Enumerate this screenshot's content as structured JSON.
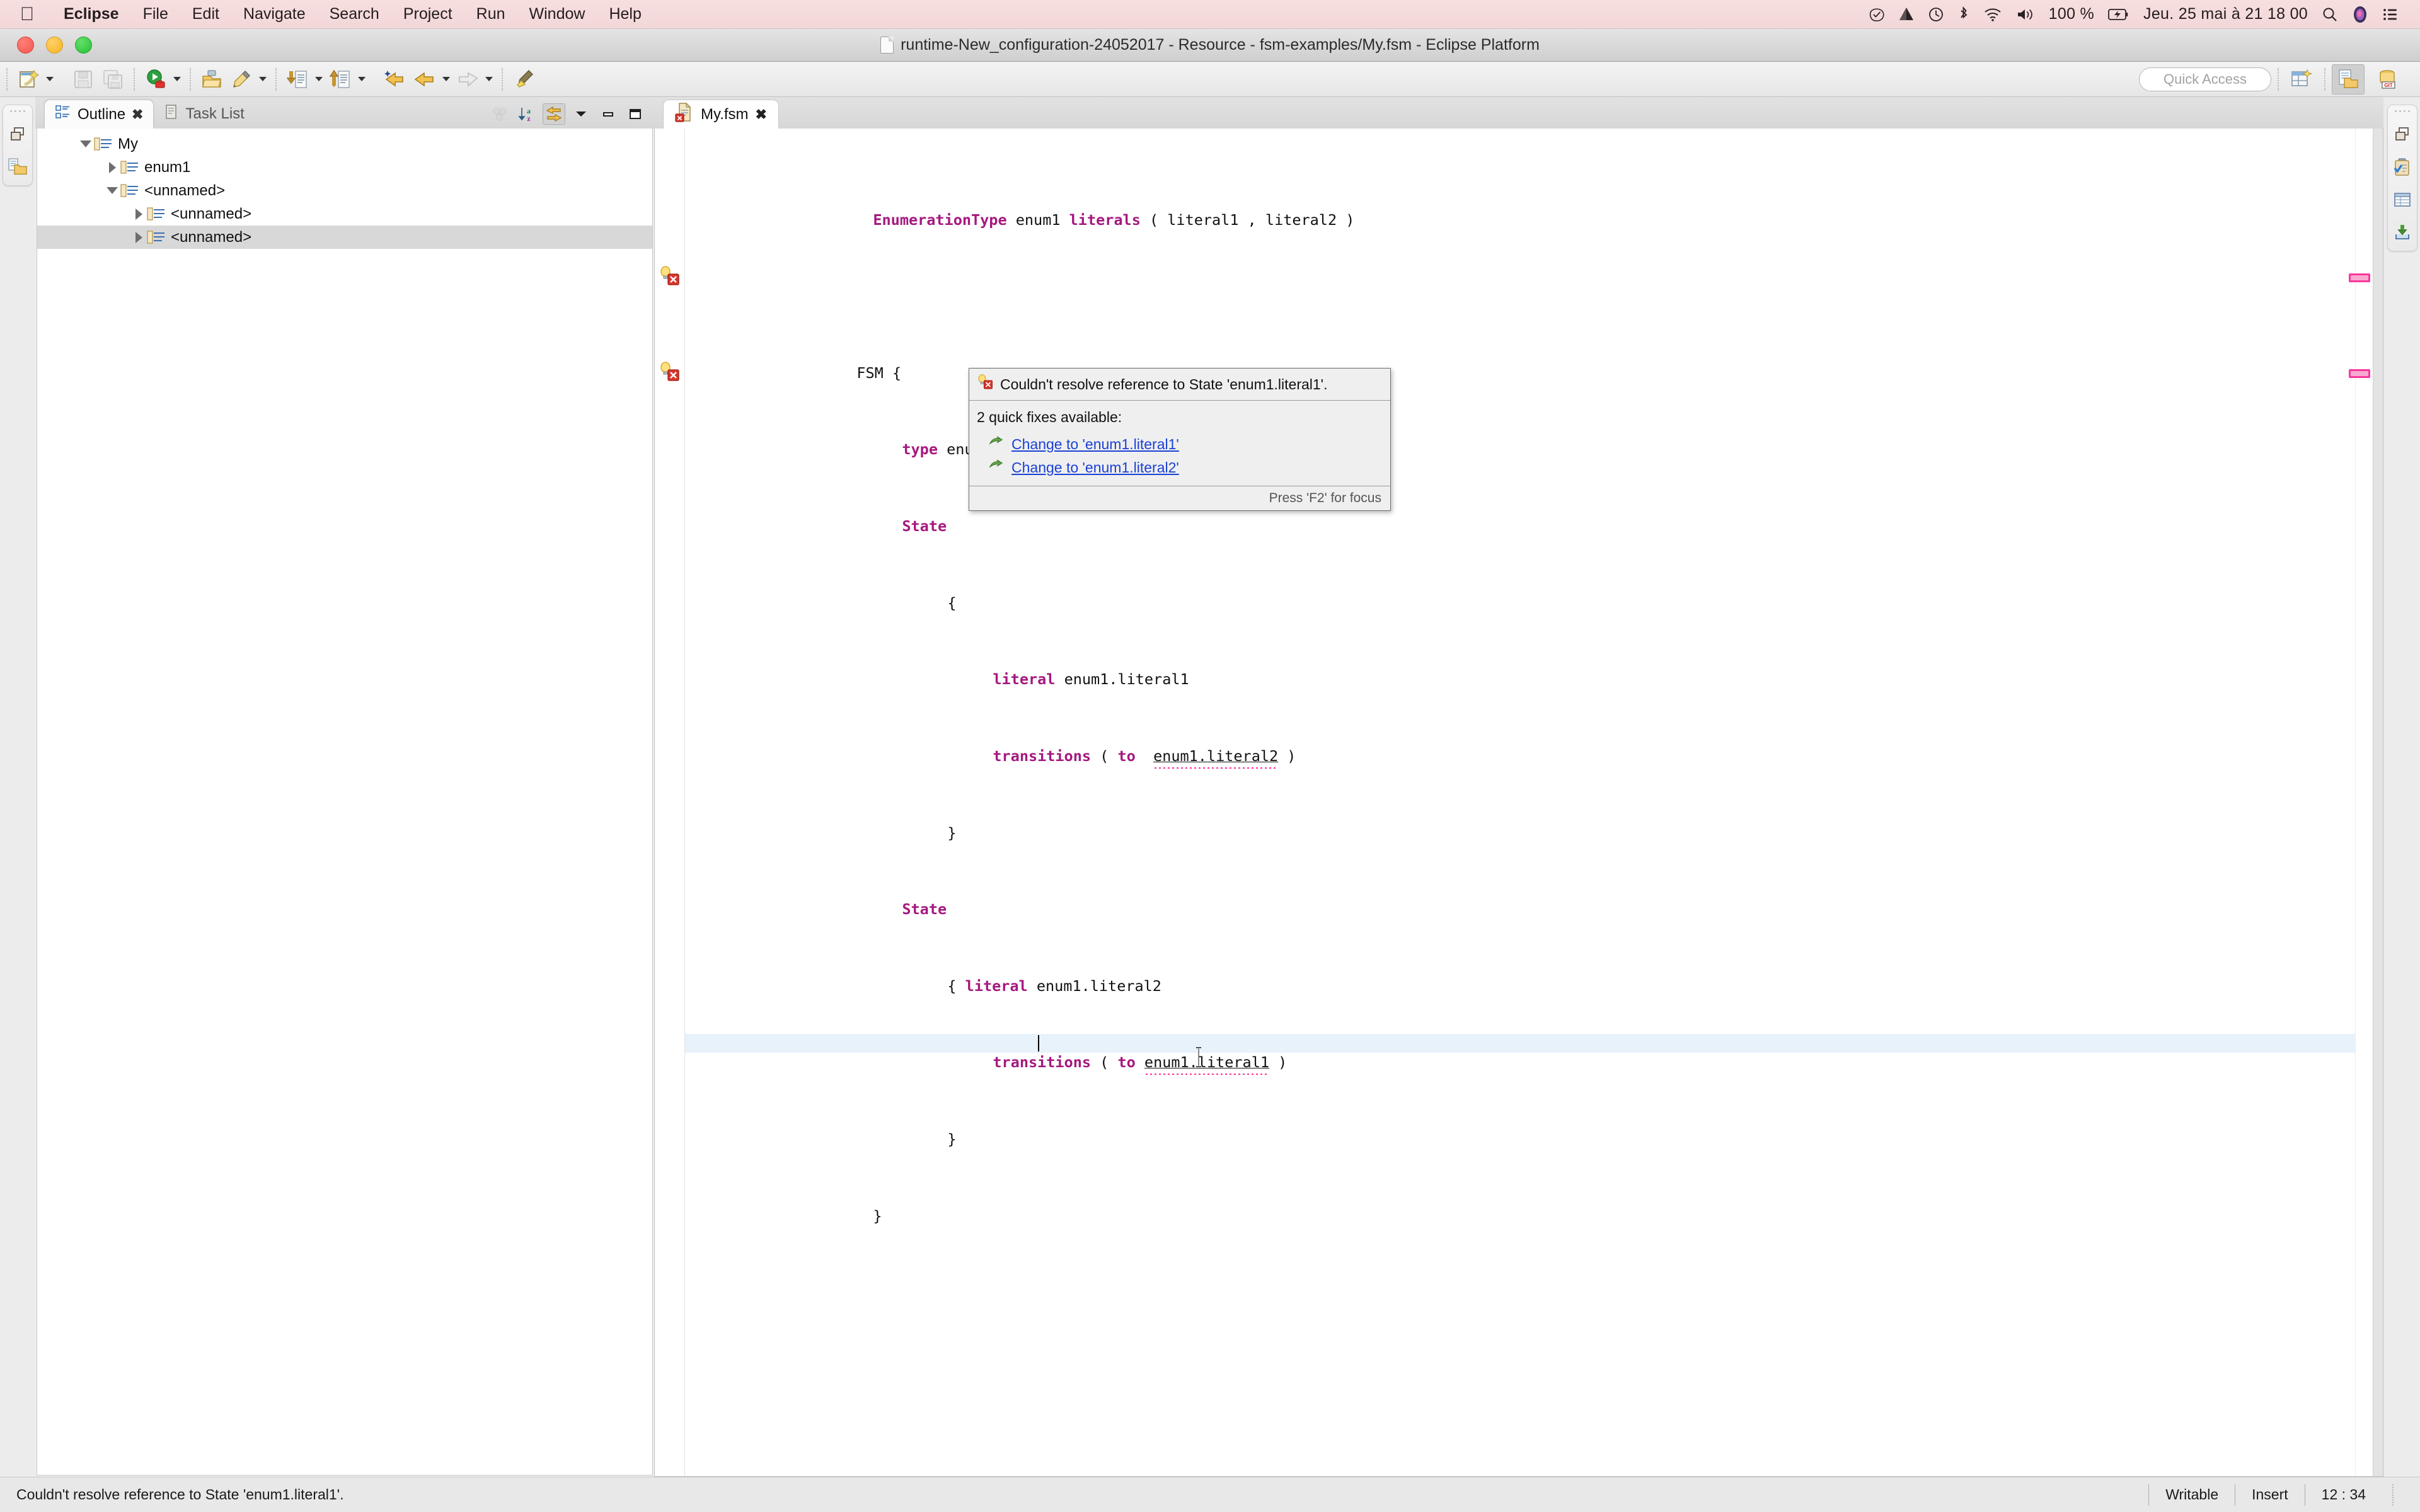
{
  "macbar": {
    "apple_icon": "apple-logo",
    "items": [
      {
        "label": "Eclipse",
        "bold": true
      },
      {
        "label": "File",
        "bold": false
      },
      {
        "label": "Edit",
        "bold": false
      },
      {
        "label": "Navigate",
        "bold": false
      },
      {
        "label": "Search",
        "bold": false
      },
      {
        "label": "Project",
        "bold": false
      },
      {
        "label": "Run",
        "bold": false
      },
      {
        "label": "Window",
        "bold": false
      },
      {
        "label": "Help",
        "bold": false
      }
    ],
    "status": {
      "battery_percent": "100 %",
      "clock": "Jeu. 25 mai à  21 18 00",
      "icons": [
        "checkbox-icon",
        "drive-icon",
        "timemachine-icon",
        "bluetooth-icon",
        "wifi-icon",
        "volume-icon",
        "battery-charging-icon",
        "spotlight-search-icon",
        "siri-icon",
        "control-center-icon"
      ]
    }
  },
  "window": {
    "title": "runtime-New_configuration-24052017 - Resource - fsm-examples/My.fsm - Eclipse Platform"
  },
  "toolbar": {
    "quick_access_placeholder": "Quick Access",
    "buttons": [
      "new-wizard-button",
      "save-button",
      "save-all-button",
      "run-button",
      "debug-button",
      "open-folder-button",
      "pencil-edit-button",
      "import-button",
      "export-button",
      "back-annotation-button",
      "back-button",
      "forward-button",
      "highlighter-button"
    ],
    "perspective_buttons": [
      "new-perspective-button",
      "resource-perspective-button",
      "git-perspective-button"
    ]
  },
  "left_trim": {
    "icons": [
      "restore-view-icon",
      "project-explorer-icon"
    ]
  },
  "right_trim": {
    "icons": [
      "restore-view-icon",
      "task-list-icon",
      "properties-view-icon",
      "console-view-icon"
    ]
  },
  "outline": {
    "tabs": [
      {
        "label": "Outline",
        "active": true,
        "icon": "outline-icon",
        "closable": true
      },
      {
        "label": "Task List",
        "active": false,
        "icon": "task-list-icon",
        "closable": false
      }
    ],
    "toolbar_icons": [
      "collapse-all-icon",
      "sort-az-icon",
      "link-with-editor-icon",
      "view-menu-icon",
      "minimize-icon",
      "maximize-icon"
    ],
    "tree": [
      {
        "label": "My",
        "depth": 0,
        "twisty": "down",
        "selected": false
      },
      {
        "label": "enum1",
        "depth": 1,
        "twisty": "right",
        "selected": false
      },
      {
        "label": "<unnamed>",
        "depth": 1,
        "twisty": "down",
        "selected": false
      },
      {
        "label": "<unnamed>",
        "depth": 2,
        "twisty": "right",
        "selected": false
      },
      {
        "label": "<unnamed>",
        "depth": 2,
        "twisty": "right",
        "selected": true
      }
    ]
  },
  "editor": {
    "tab": {
      "label": "My.fsm",
      "icon": "fsm-file-error-icon",
      "close_label": "✕"
    },
    "lines": [
      {
        "indent": 1,
        "tokens": [
          {
            "t": "EnumerationType",
            "k": true
          },
          {
            "t": " enum1 ",
            "k": false
          },
          {
            "t": "literals",
            "k": true
          },
          {
            "t": " ( literal1 , literal2 )",
            "k": false
          }
        ]
      },
      {
        "indent": 0,
        "tokens": []
      },
      {
        "indent": 0,
        "fold": true,
        "tokens": [
          {
            "t": "FSM {",
            "k": false
          }
        ]
      },
      {
        "indent": 2,
        "tokens": [
          {
            "t": "type",
            "k": true
          },
          {
            "t": " enum1",
            "k": false
          }
        ]
      },
      {
        "indent": 2,
        "fold": true,
        "tokens": [
          {
            "t": "State",
            "k": true
          }
        ]
      },
      {
        "indent": 3,
        "tokens": [
          {
            "t": "{",
            "k": false
          }
        ]
      },
      {
        "indent": 4,
        "tokens": [
          {
            "t": "literal",
            "k": true
          },
          {
            "t": " enum1.literal1",
            "k": false
          }
        ]
      },
      {
        "indent": 4,
        "error": true,
        "tokens": [
          {
            "t": "transitions",
            "k": true
          },
          {
            "t": " ( ",
            "k": false
          },
          {
            "t": "to",
            "k": true
          },
          {
            "t": "  ",
            "k": false
          },
          {
            "t": "enum1.literal2",
            "k": false,
            "err": true
          },
          {
            "t": " )",
            "k": false
          }
        ]
      },
      {
        "indent": 3,
        "tokens": [
          {
            "t": "}",
            "k": false
          }
        ]
      },
      {
        "indent": 2,
        "fold": true,
        "tokens": [
          {
            "t": "State",
            "k": true
          }
        ]
      },
      {
        "indent": 3,
        "tokens": [
          {
            "t": "{ ",
            "k": false
          },
          {
            "t": "literal",
            "k": true
          },
          {
            "t": " enum1.literal2",
            "k": false
          }
        ]
      },
      {
        "indent": 4,
        "error": true,
        "current": true,
        "caret": true,
        "tokens": [
          {
            "t": "transitions",
            "k": true
          },
          {
            "t": " ( ",
            "k": false
          },
          {
            "t": "to",
            "k": true
          },
          {
            "t": " ",
            "k": false
          },
          {
            "t": "enum1.literal1",
            "k": false,
            "err": true
          },
          {
            "t": " )",
            "k": false
          }
        ]
      },
      {
        "indent": 3,
        "tokens": [
          {
            "t": "}",
            "k": false
          }
        ]
      },
      {
        "indent": 1,
        "tokens": [
          {
            "t": "}",
            "k": false
          }
        ]
      }
    ]
  },
  "quickfix": {
    "title": "Couldn't resolve reference to State 'enum1.literal1'.",
    "subtitle": "2 quick fixes available:",
    "items": [
      {
        "label": "Change to 'enum1.literal1'",
        "icon": "quickfix-arrow-icon"
      },
      {
        "label": "Change to 'enum1.literal2'",
        "icon": "quickfix-arrow-icon"
      }
    ],
    "footer": "Press 'F2' for focus"
  },
  "statusbar": {
    "message": "Couldn't resolve reference to State 'enum1.literal1'.",
    "writable": "Writable",
    "insert_mode": "Insert",
    "position": "12 : 34"
  },
  "colors": {
    "keyword": "#a5197f",
    "error_squiggle": "#ff1a8c",
    "link": "#1a41d6",
    "current_line": "#e8f2fb",
    "selection": "#d8d8d8"
  }
}
